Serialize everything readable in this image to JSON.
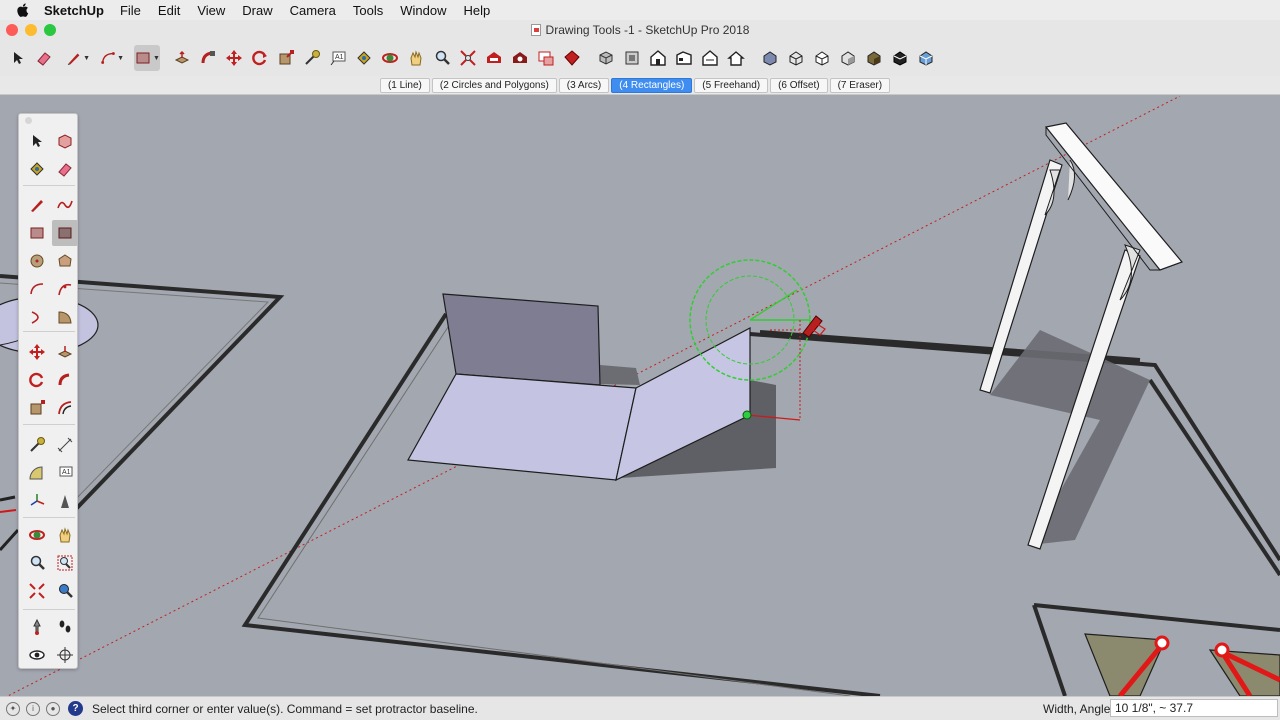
{
  "menubar": {
    "app_name": "SketchUp",
    "items": [
      "File",
      "Edit",
      "View",
      "Draw",
      "Camera",
      "Tools",
      "Window",
      "Help"
    ]
  },
  "window": {
    "title": "Drawing Tools -1 - SketchUp Pro 2018"
  },
  "toolbar": {
    "icons": [
      "select-icon",
      "eraser-icon",
      "pencil-icon",
      "arc-icon",
      "rectangle-icon",
      "push-pull-icon",
      "follow-me-icon",
      "move-icon",
      "rotate-icon",
      "scale-icon",
      "tape-measure-icon",
      "text-icon",
      "paint-bucket-icon",
      "orbit-icon",
      "pan-icon",
      "zoom-icon",
      "zoom-extents-icon",
      "warehouse-icon",
      "extension-warehouse-icon",
      "layout-icon",
      "ruby-icon",
      "iso-view-icon",
      "top-view-icon",
      "front-view-icon",
      "right-view-icon",
      "back-view-icon",
      "left-view-icon",
      "xray-icon",
      "wireframe-icon",
      "hidden-line-icon",
      "shaded-icon",
      "textured-icon",
      "monochrome-icon"
    ]
  },
  "scene_tabs": [
    {
      "label": "(1 Line)",
      "active": false
    },
    {
      "label": "(2 Circles and Polygons)",
      "active": false
    },
    {
      "label": "(3 Arcs)",
      "active": false
    },
    {
      "label": "(4 Rectangles)",
      "active": true
    },
    {
      "label": "(5 Freehand)",
      "active": false
    },
    {
      "label": "(6 Offset)",
      "active": false
    },
    {
      "label": "(7 Eraser)",
      "active": false
    }
  ],
  "palette": {
    "tools": [
      "select-icon",
      "make-component-icon",
      "paint-bucket-icon",
      "eraser-icon",
      "line-icon",
      "freehand-icon",
      "rectangle-icon",
      "rotated-rectangle-icon",
      "circle-icon",
      "polygon-icon",
      "arc-icon",
      "two-point-arc-icon",
      "three-point-arc-icon",
      "pie-icon",
      "move-icon",
      "push-pull-icon",
      "rotate-icon",
      "follow-me-icon",
      "scale-icon",
      "offset-icon",
      "tape-measure-icon",
      "dimension-icon",
      "protractor-icon",
      "text-icon",
      "axes-icon",
      "3d-text-icon",
      "orbit-icon",
      "pan-icon",
      "zoom-icon",
      "zoom-window-icon",
      "zoom-extents-icon",
      "previous-view-icon",
      "position-camera-icon",
      "walk-icon",
      "look-around-icon",
      "section-plane-icon"
    ],
    "selected": "rotated-rectangle-icon"
  },
  "status": {
    "message": "Select third corner or enter value(s). Command = set protractor baseline.",
    "vcb_label": "Width, Angle",
    "vcb_value": "10 1/8\", ~ 37.7"
  },
  "colors": {
    "viewport_bg": "#a3a7b0",
    "face_front": "#c3c3e0",
    "face_back": "#7e7d92",
    "active_tab": "#3f8df0",
    "protractor": "#33cc33",
    "axis_red": "#d01818"
  }
}
